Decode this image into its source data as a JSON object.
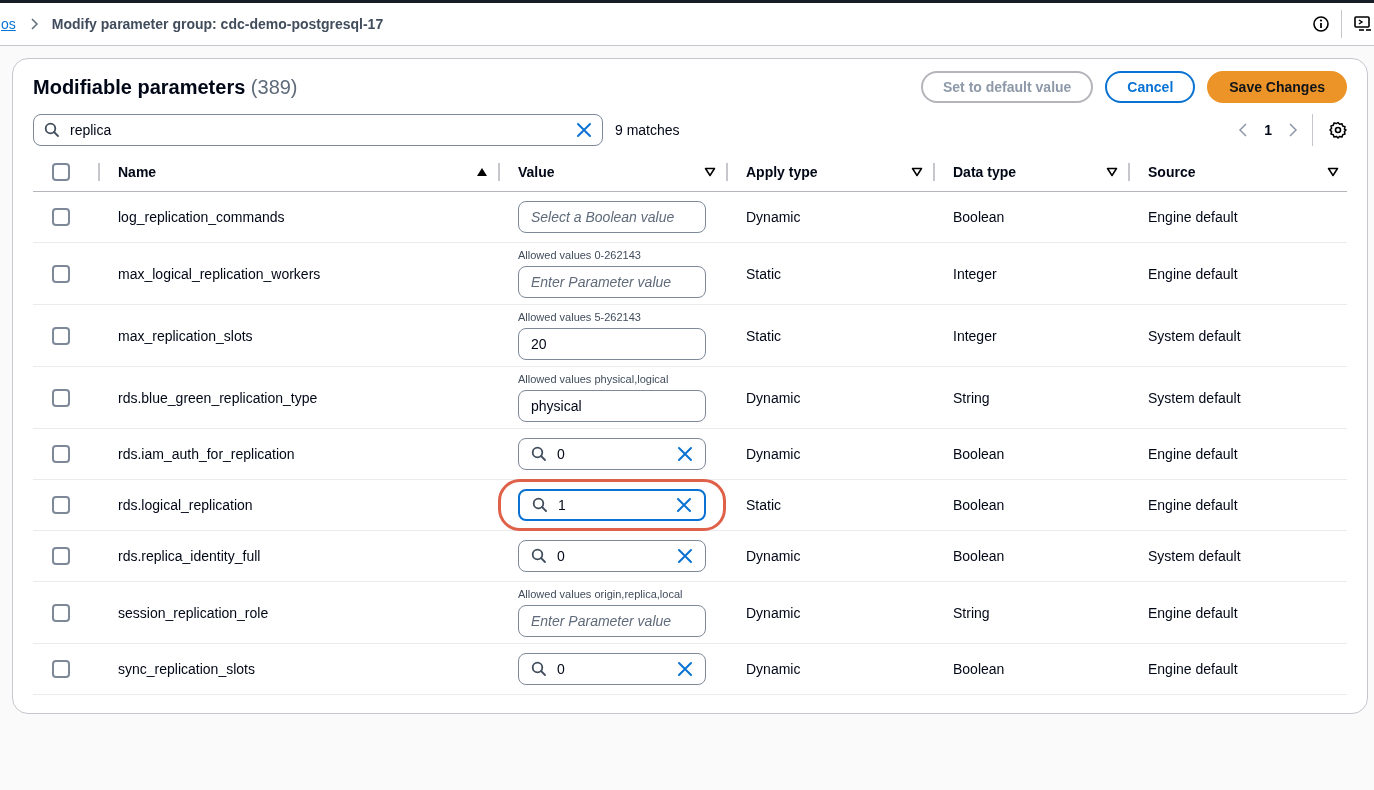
{
  "breadcrumb": {
    "link": "os",
    "current": "Modify parameter group: cdc-demo-postgresql-17"
  },
  "panel": {
    "title": "Modifiable parameters",
    "count": "(389)",
    "buttons": [
      {
        "label": "Set to default value",
        "kind": "disabled"
      },
      {
        "label": "Cancel",
        "kind": "normal"
      },
      {
        "label": "Save Changes",
        "kind": "primary"
      }
    ],
    "filter": {
      "value": "replica",
      "matches": "9 matches"
    },
    "pagination": {
      "page": "1"
    }
  },
  "table": {
    "all_checked": false,
    "columns": [
      {
        "label": "Name",
        "sorted": true
      },
      {
        "label": "Value",
        "sorted": false
      },
      {
        "label": "Apply type",
        "sorted": false
      },
      {
        "label": "Data type",
        "sorted": false
      },
      {
        "label": "Source",
        "sorted": false
      }
    ],
    "rows": [
      {
        "checked": false,
        "name": "log_replication_commands",
        "value": {
          "kind": "select",
          "placeholder": "Select a Boolean value"
        },
        "apply_type": "Dynamic",
        "data_type": "Boolean",
        "source": "Engine default"
      },
      {
        "checked": false,
        "name": "max_logical_replication_workers",
        "value": {
          "kind": "text",
          "hint": "Allowed values 0-262143",
          "placeholder": "Enter Parameter value"
        },
        "apply_type": "Static",
        "data_type": "Integer",
        "source": "Engine default"
      },
      {
        "checked": false,
        "name": "max_replication_slots",
        "value": {
          "kind": "text",
          "hint": "Allowed values 5-262143",
          "value": "20"
        },
        "apply_type": "Static",
        "data_type": "Integer",
        "source": "System default"
      },
      {
        "checked": false,
        "name": "rds.blue_green_replication_type",
        "value": {
          "kind": "text",
          "hint": "Allowed values physical,logical",
          "value": "physical"
        },
        "apply_type": "Dynamic",
        "data_type": "String",
        "source": "System default"
      },
      {
        "checked": false,
        "name": "rds.iam_auth_for_replication",
        "value": {
          "kind": "search",
          "value": "0",
          "focused": false,
          "circled": false
        },
        "apply_type": "Dynamic",
        "data_type": "Boolean",
        "source": "Engine default"
      },
      {
        "checked": false,
        "name": "rds.logical_replication",
        "value": {
          "kind": "search",
          "value": "1",
          "focused": true,
          "circled": true
        },
        "apply_type": "Static",
        "data_type": "Boolean",
        "source": "Engine default"
      },
      {
        "checked": false,
        "name": "rds.replica_identity_full",
        "value": {
          "kind": "search",
          "value": "0",
          "focused": false,
          "circled": false
        },
        "apply_type": "Dynamic",
        "data_type": "Boolean",
        "source": "System default"
      },
      {
        "checked": false,
        "name": "session_replication_role",
        "value": {
          "kind": "text",
          "hint": "Allowed values origin,replica,local",
          "placeholder": "Enter Parameter value"
        },
        "apply_type": "Dynamic",
        "data_type": "String",
        "source": "Engine default"
      },
      {
        "checked": false,
        "name": "sync_replication_slots",
        "value": {
          "kind": "search",
          "value": "0",
          "focused": false,
          "circled": false
        },
        "apply_type": "Dynamic",
        "data_type": "Boolean",
        "source": "Engine default"
      }
    ]
  }
}
